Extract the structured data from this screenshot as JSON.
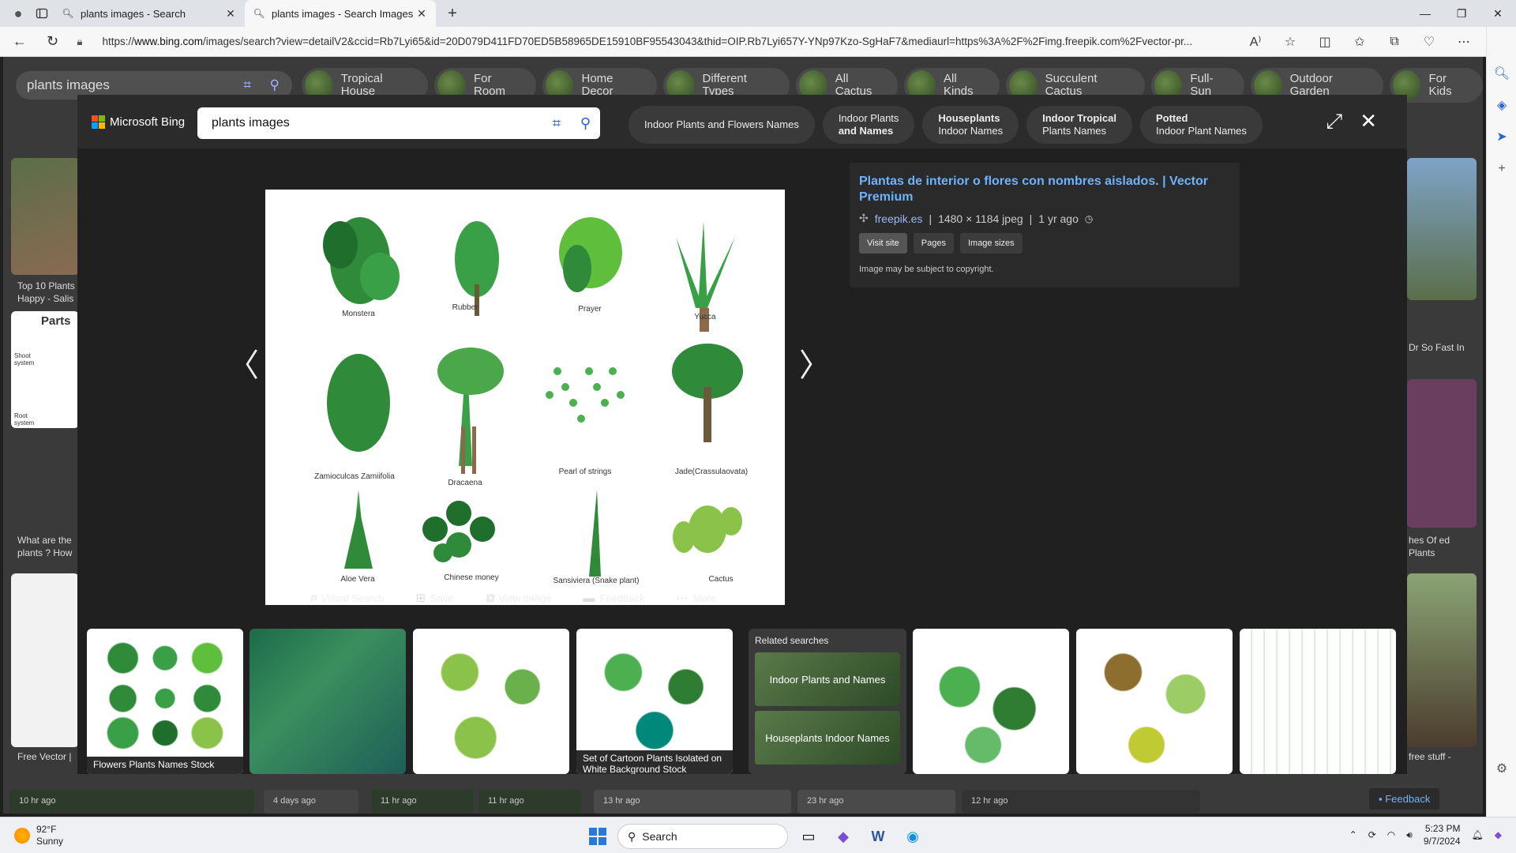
{
  "browser": {
    "tabs": [
      {
        "title": "plants images - Search",
        "active": false
      },
      {
        "title": "plants images - Search Images",
        "active": true
      }
    ],
    "url_prefix": "https://",
    "url_domain": "www.bing.com",
    "url_rest": "/images/search?view=detailV2&ccid=Rb7Lyi65&id=20D079D411FD70ED5B58965DE15910BF95543043&thid=OIP.Rb7Lyi657Y-YNp97Kzo-SgHaF7&mediaurl=https%3A%2F%2Fimg.freepik.com%2Fvector-pr..."
  },
  "page": {
    "search_query": "plants images",
    "pills": [
      "Tropical House",
      "For Room",
      "Home Decor",
      "Different Types",
      "All Cactus",
      "All Kinds",
      "Succulent Cactus",
      "Full-Sun",
      "Outdoor Garden",
      "For Kids"
    ],
    "bg_texts": {
      "t1": "Top 10 Plants Happy - Salis",
      "t2": "What are the plants ? How",
      "t3": "Free Vector |",
      "t4": "Dr So Fast In",
      "t5": "hes Of ed Plants",
      "t6": "free stuff -",
      "parts": "Parts",
      "shoot": "Shoot system",
      "root": "Root system"
    },
    "strip_times": [
      "10 hr ago",
      "4 days ago",
      "11 hr ago",
      "11 hr ago",
      "13 hr ago",
      "23 hr ago",
      "12 hr ago"
    ],
    "feedback": "Feedback"
  },
  "modal": {
    "brand": "Microsoft Bing",
    "search_value": "plants images",
    "related_chips": [
      {
        "line1": "Indoor Plants and Flowers Names",
        "line2": ""
      },
      {
        "line1": "Indoor Plants",
        "line2": "and Names"
      },
      {
        "line1": "Houseplants",
        "line2": "Indoor Names"
      },
      {
        "line1": "Indoor Tropical",
        "line2": "Plants Names"
      },
      {
        "line1": "Potted",
        "line2": "Indoor Plant Names"
      }
    ],
    "image_labels": [
      "Monstera",
      "Rubber",
      "Prayer",
      "Yucca",
      "Zamioculcas Zamiifolia",
      "Dracaena",
      "Pearl of strings",
      "Jade(Crassulaovata)",
      "Aloe Vera",
      "Chinese money",
      "Sansiviera (Snake plant)",
      "Cactus"
    ],
    "info": {
      "title": "Plantas de interior o flores con nombres aislados. | Vector Premium",
      "source": "freepik.es",
      "dims": "1480 × 1184 jpeg",
      "age": "1 yr ago",
      "buttons": [
        "Visit site",
        "Pages",
        "Image sizes"
      ],
      "copyright": "Image may be subject to copyright."
    },
    "actions": [
      "Visual Search",
      "Save",
      "View image",
      "Feedback",
      "More"
    ],
    "thumb_captions": [
      "Flowers Plants Names Stock",
      "Set of Cartoon Plants Isolated on White Background Stock"
    ],
    "related_header": "Related searches",
    "related_items": [
      "Indoor Plants and Names",
      "Houseplants Indoor Names"
    ]
  },
  "taskbar": {
    "temp": "92°F",
    "cond": "Sunny",
    "search_placeholder": "Search",
    "time": "5:23 PM",
    "date": "9/7/2024"
  }
}
